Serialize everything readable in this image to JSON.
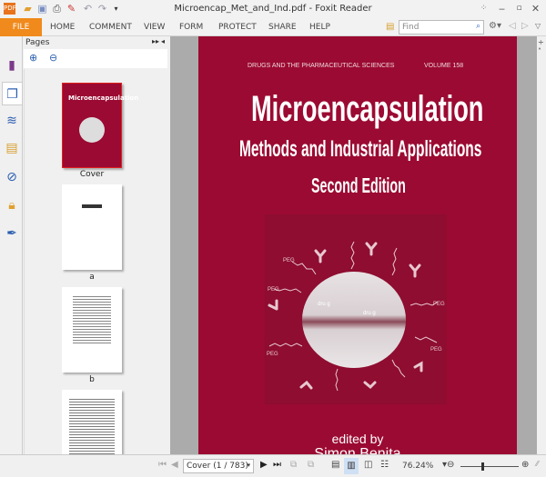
{
  "window": {
    "title": "Microencap_Met_and_Ind.pdf - Foxit Reader"
  },
  "ribbon": {
    "file": "FILE",
    "tabs": [
      "HOME",
      "COMMENT",
      "VIEW",
      "FORM",
      "PROTECT",
      "SHARE",
      "HELP"
    ],
    "find_placeholder": "Find"
  },
  "panel": {
    "title": "Pages",
    "thumbnails": [
      {
        "label": "Cover"
      },
      {
        "label": "a"
      },
      {
        "label": "b"
      },
      {
        "label": ""
      }
    ]
  },
  "cover": {
    "series": "DRUGS AND THE PHARMACEUTICAL SCIENCES",
    "volume": "VOLUME 158",
    "title": "Microencapsulation",
    "subtitle": "Methods and Industrial Applications",
    "edition": "Second Edition",
    "edited_by": "edited by",
    "editor": "Simon Benita",
    "figure_labels": {
      "peg": "PEG",
      "drug": "dru g"
    }
  },
  "status": {
    "page_select": "Cover (1 / 783)",
    "zoom": "76.24%"
  },
  "colors": {
    "accent": "#f08a1c",
    "cover": "#9b0a32"
  }
}
